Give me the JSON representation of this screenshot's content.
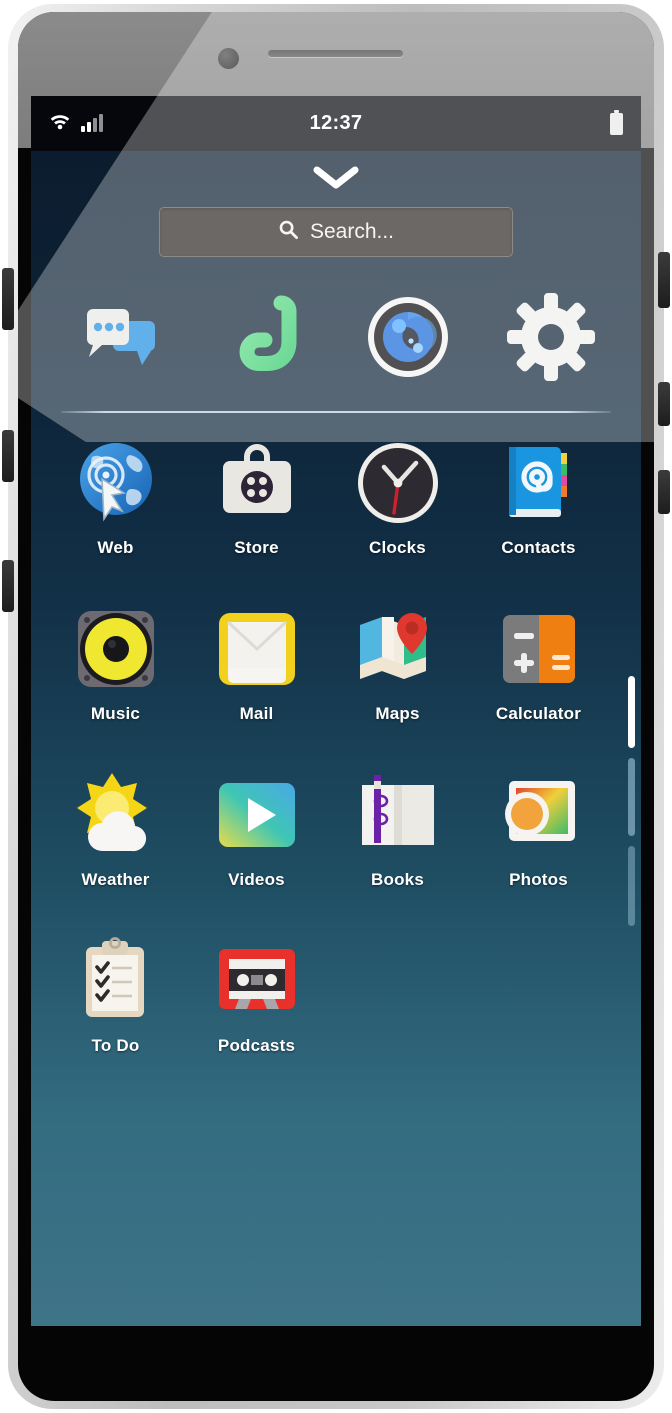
{
  "device": {
    "frame": "smartphone-mockup",
    "bezel_color": "#cfcfcf"
  },
  "status_bar": {
    "wifi_icon": "wifi-icon",
    "signal_icon": "cellular-signal-icon",
    "time": "12:37",
    "battery_icon": "battery-icon"
  },
  "home": {
    "pull_down_icon": "chevron-down-icon",
    "search": {
      "icon": "search-icon",
      "placeholder": "Search...",
      "value": ""
    },
    "favorites": [
      {
        "label": "Messages",
        "icon": "messages-icon"
      },
      {
        "label": "Phone",
        "icon": "phone-icon"
      },
      {
        "label": "Camera",
        "icon": "camera-icon"
      },
      {
        "label": "Settings",
        "icon": "settings-gear-icon"
      }
    ],
    "apps": [
      {
        "label": "Web",
        "icon": "web-browser-icon"
      },
      {
        "label": "Store",
        "icon": "store-bag-icon"
      },
      {
        "label": "Clocks",
        "icon": "clock-icon"
      },
      {
        "label": "Contacts",
        "icon": "contacts-book-icon"
      },
      {
        "label": "Music",
        "icon": "music-speaker-icon"
      },
      {
        "label": "Mail",
        "icon": "mail-envelope-icon"
      },
      {
        "label": "Maps",
        "icon": "maps-pin-icon"
      },
      {
        "label": "Calculator",
        "icon": "calculator-icon"
      },
      {
        "label": "Weather",
        "icon": "weather-sun-cloud-icon"
      },
      {
        "label": "Videos",
        "icon": "videos-play-icon"
      },
      {
        "label": "Books",
        "icon": "books-open-icon"
      },
      {
        "label": "Photos",
        "icon": "photos-frame-icon"
      },
      {
        "label": "To Do",
        "icon": "todo-clipboard-icon"
      },
      {
        "label": "Podcasts",
        "icon": "podcasts-cassette-icon"
      }
    ],
    "page_indicator": {
      "pages": 3,
      "active": 1
    },
    "colors": {
      "wallpaper_top": "#0b1c2e",
      "wallpaper_bottom": "#3f7488",
      "search_background": "#2b2724",
      "label_text": "#ffffff"
    }
  }
}
